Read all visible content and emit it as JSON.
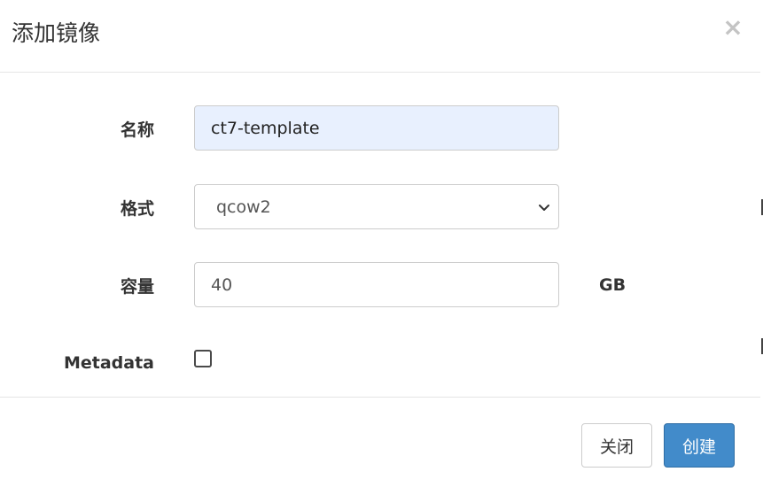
{
  "modal": {
    "title": "添加镜像",
    "close_glyph": "×"
  },
  "form": {
    "name": {
      "label": "名称",
      "value": "ct7-template"
    },
    "format": {
      "label": "格式",
      "selected": "qcow2"
    },
    "capacity": {
      "label": "容量",
      "value": "40",
      "unit": "GB"
    },
    "metadata": {
      "label": "Metadata",
      "checked": false
    }
  },
  "footer": {
    "close_label": "关闭",
    "create_label": "创建"
  },
  "colors": {
    "primary": "#428bca",
    "autofill_bg": "#e8f0fe"
  }
}
